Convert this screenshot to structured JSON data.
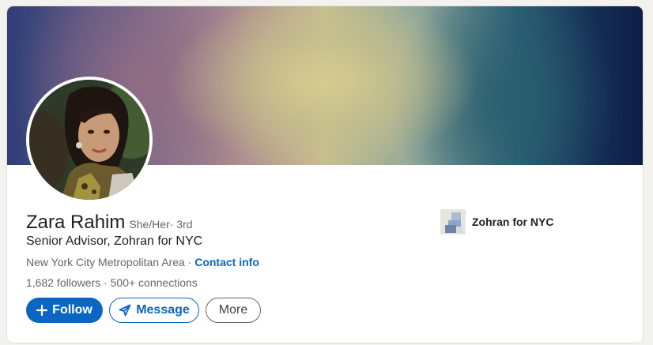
{
  "profile": {
    "name": "Zara Rahim",
    "pronouns": "She/Her",
    "degree": " · 3rd",
    "headline": "Senior Advisor, Zohran for NYC",
    "location": "New York City Metropolitan Area",
    "location_sep": " · ",
    "contact_label": "Contact info",
    "followers": "1,682 followers",
    "stats_sep": " · ",
    "connections": "500+ connections"
  },
  "actions": {
    "follow_label": "Follow",
    "message_label": "Message",
    "more_label": "More"
  },
  "company": {
    "name": "Zohran for NYC"
  },
  "icons": {
    "follow": "plus-icon",
    "message": "send-icon"
  },
  "colors": {
    "accent": "#0a66c2",
    "text_primary": "#1f1f1f",
    "text_secondary": "#666666"
  }
}
